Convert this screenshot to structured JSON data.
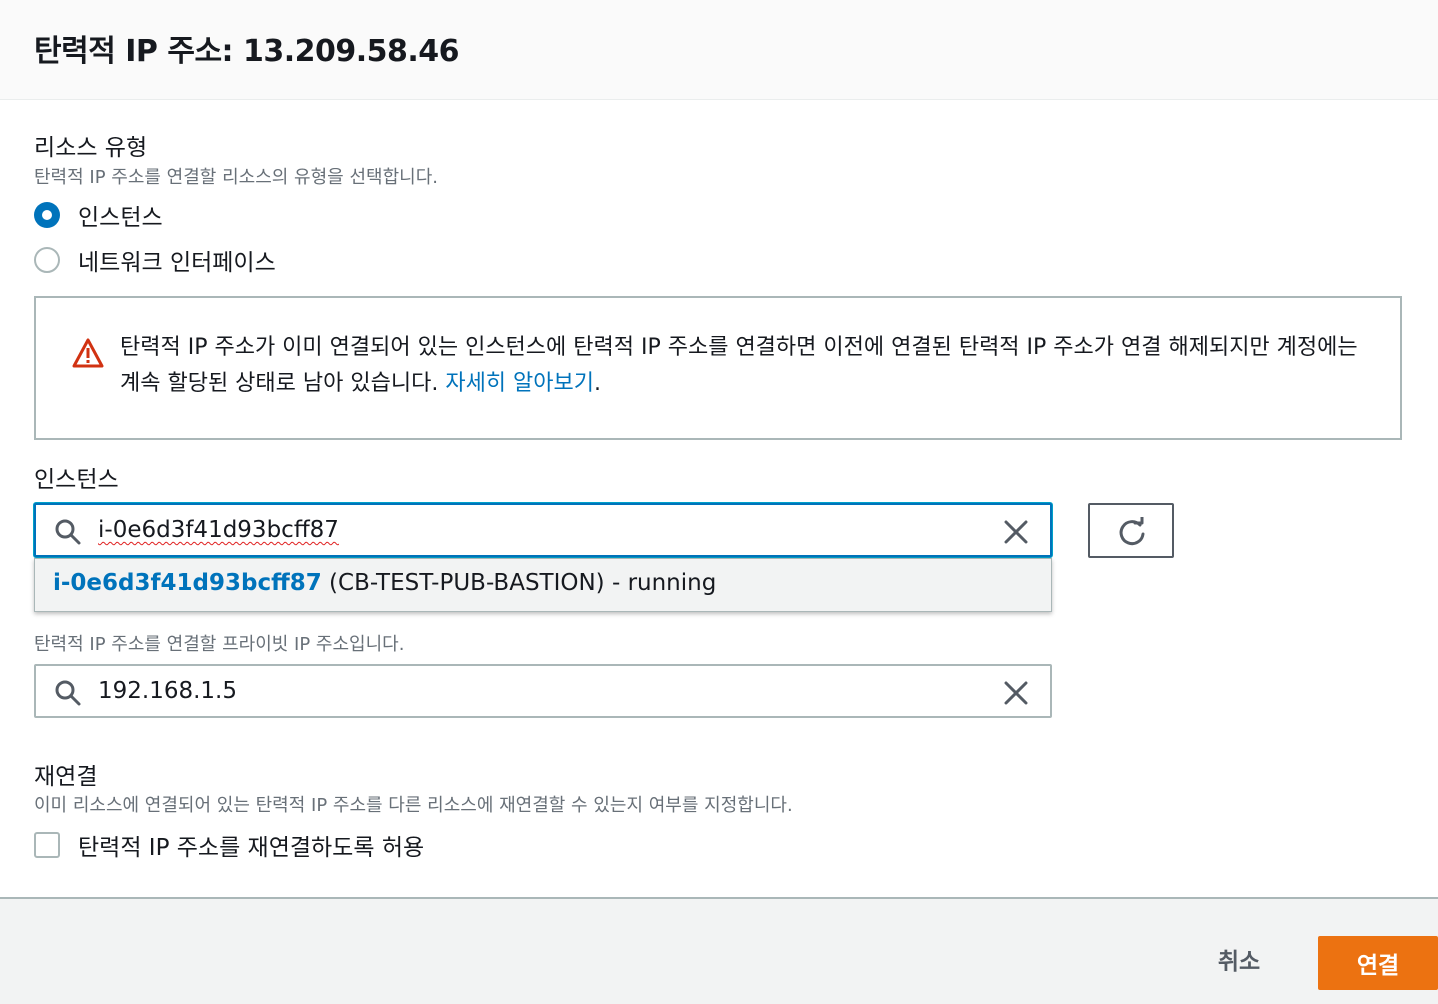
{
  "dialog": {
    "title": "탄력적 IP 주소: 13.209.58.46"
  },
  "resource_type": {
    "label": "리소스 유형",
    "description": "탄력적 IP 주소를 연결할 리소스의 유형을 선택합니다.",
    "options": [
      {
        "label": "인스턴스",
        "selected": true
      },
      {
        "label": "네트워크 인터페이스",
        "selected": false
      }
    ]
  },
  "alert": {
    "icon": "warning-icon",
    "text": "탄력적 IP 주소가 이미 연결되어 있는 인스턴스에 탄력적 IP 주소를 연결하면 이전에 연결된 탄력적 IP 주소가 연결 해제되지만 계정에는 계속 할당된 상태로 남아 있습니다.",
    "link": "자세히 알아보기",
    "suffix": "."
  },
  "instance": {
    "label": "인스턴스",
    "value": "i-0e6d3f41d93bcff87",
    "dropdown_option": {
      "id": "i-0e6d3f41d93bcff87",
      "detail": "(CB-TEST-PUB-BASTION) - running"
    }
  },
  "private_ip": {
    "description": "탄력적 IP 주소를 연결할 프라이빗 IP 주소입니다.",
    "value": "192.168.1.5"
  },
  "reassociation": {
    "label": "재연결",
    "description": "이미 리소스에 연결되어 있는 탄력적 IP 주소를 다른 리소스에 재연결할 수 있는지 여부를 지정합니다.",
    "checkbox_label": "탄력적 IP 주소를 재연결하도록 허용",
    "checked": false
  },
  "footer": {
    "cancel_label": "취소",
    "connect_label": "연결"
  },
  "colors": {
    "accent": "#0073bb",
    "primary_button": "#ec7211",
    "warning": "#d13212"
  }
}
